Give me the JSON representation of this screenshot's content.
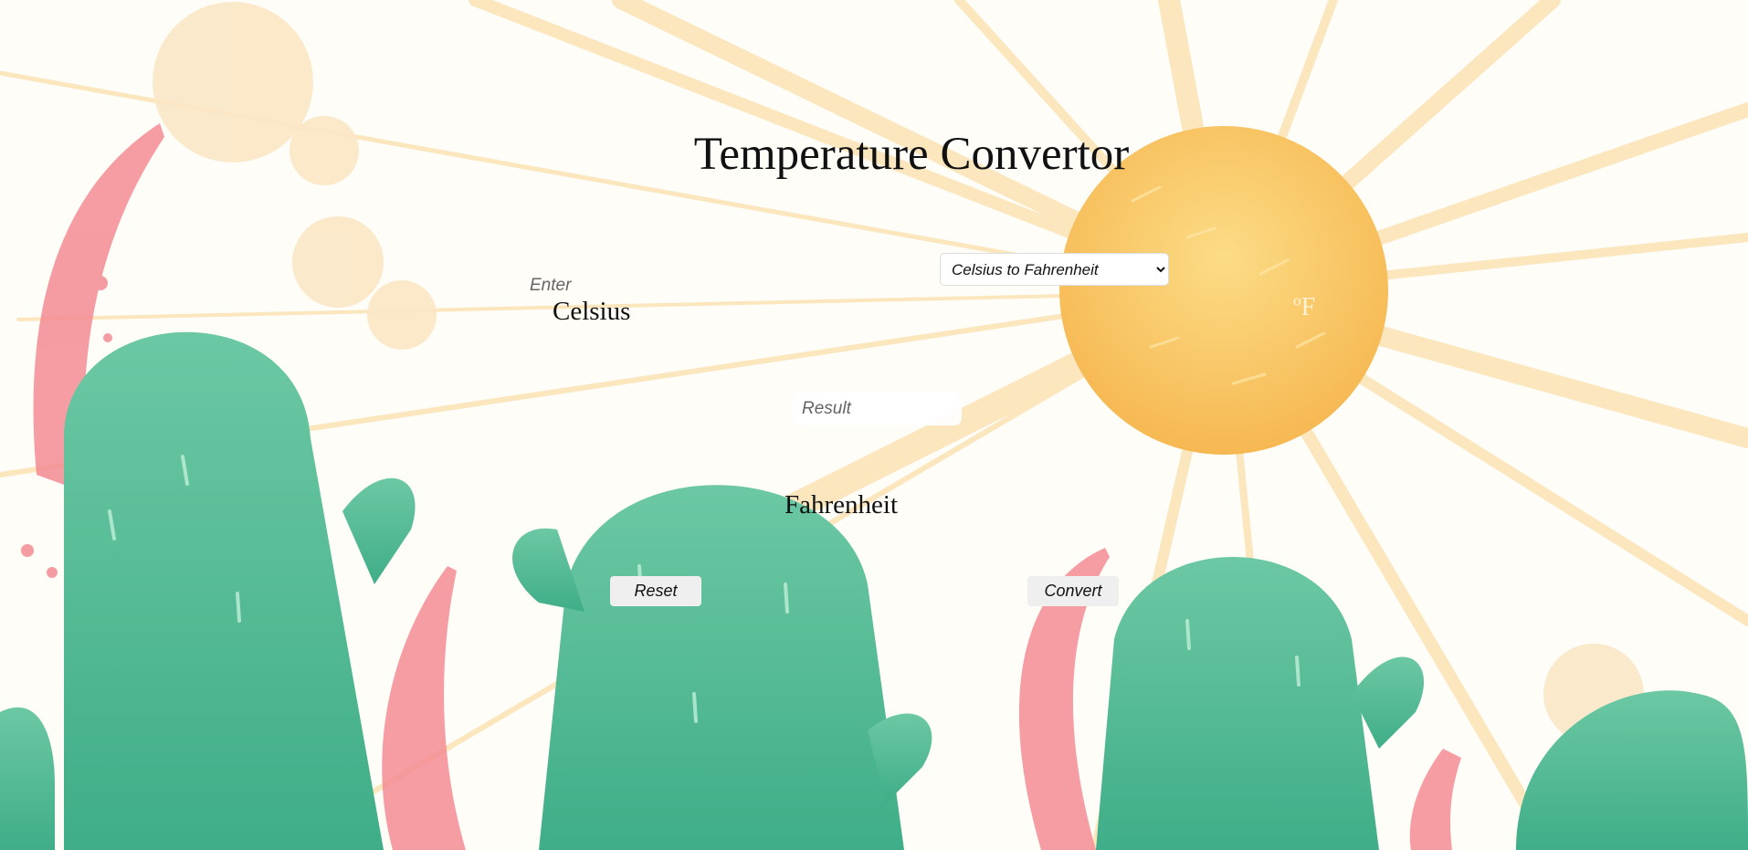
{
  "page": {
    "title": "Temperature Convertor"
  },
  "form": {
    "enter_placeholder": "Enter",
    "input_unit_label": "Celsius",
    "mode_select": {
      "selected": "Celsius to Fahrenheit",
      "options": [
        "Celsius to Fahrenheit"
      ]
    },
    "unit_symbol": "ºF",
    "result_placeholder": "Result",
    "output_unit_label": "Fahrenheit",
    "reset_label": "Reset",
    "convert_label": "Convert"
  },
  "background": {
    "sun_color": "#f8c664",
    "ray_color": "#fbe3b4",
    "cactus_color": "#5ec5a0",
    "petal_color": "#f48b94"
  }
}
